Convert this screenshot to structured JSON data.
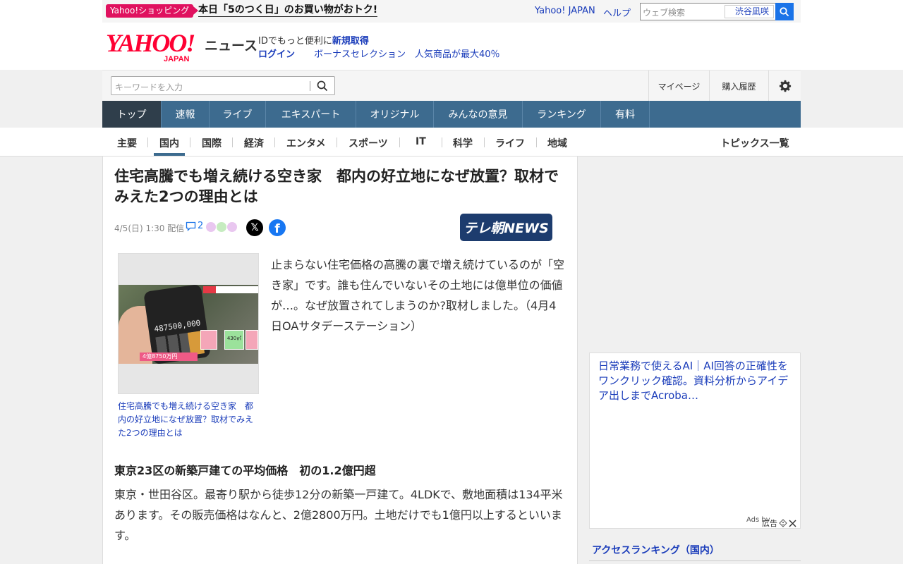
{
  "topbar": {
    "promo_badge": "Yahoo!ショッピング",
    "promo_text": "本日「5のつく日」のお買い物がおトク!",
    "links": [
      "Yahoo! JAPAN",
      "ヘルプ"
    ],
    "web_search_placeholder": "ウェブ検索",
    "web_search_scope": "渋谷凪咲"
  },
  "header": {
    "logo_main": "YAHOO!",
    "logo_sub": "JAPAN",
    "section": "ニュース",
    "id_text": "IDでもっと便利に",
    "id_link": "新規取得",
    "login": "ログイン",
    "promo": "ボーナスセレクション　人気商品が最大40％"
  },
  "toolbar": {
    "search_placeholder": "キーワードを入力",
    "mypage": "マイページ",
    "purchase_history": "購入履歴",
    "settings_icon": "gear-icon"
  },
  "global_nav": [
    "トップ",
    "速報",
    "ライブ",
    "エキスパート",
    "オリジナル",
    "みんなの意見",
    "ランキング",
    "有料"
  ],
  "global_nav_active": "トップ",
  "sub_nav": [
    "主要",
    "国内",
    "国際",
    "経済",
    "エンタメ",
    "スポーツ",
    "IT",
    "科学",
    "ライフ",
    "地域"
  ],
  "sub_nav_active": "国内",
  "topics_link": "トピックス一覧",
  "article": {
    "title": "住宅高騰でも増え続ける空き家　都内の好立地になぜ放置？取材でみえた2つの理由とは",
    "date": "4/5(日) 1:30 配信",
    "comment_count": "2",
    "source": "テレ朝NEWS",
    "photo_caption": "住宅高騰でも増え続ける空き家　都内の好立地になぜ放置？取材でみえた2つの理由とは",
    "photo_text": {
      "calc_number": "487500,000",
      "price_tag": "4億8750万円",
      "plot_area": "430㎡"
    },
    "lead": "止まらない住宅価格の高騰の裏で増え続けているのが「空き家」です。誰も住んでいないその土地には億単位の価値が…。なぜ放置されてしまうのか?取材しました。（4月4日OAサタデーステーション）",
    "subhead": "東京23区の新築戸建ての平均価格　初の1.2億円超",
    "body": "東京・世田谷区。最寄り駅から徒歩12分の新築一戸建て。4LDKで、敷地面積は134平米あります。その販売価格はなんと、2億2800万円。土地だけでも1億円以上するといいます。"
  },
  "sidebar": {
    "ad_text": "日常業務で使えるAI｜AI回答の正確性をワンクリック確認。資料分析からアイデア出しまでAcroba…",
    "ad_choices": "Ads by",
    "ad_label": "広告",
    "ranking_title": "アクセスランキング（国内）"
  },
  "colors": {
    "brand_red": "#ff0033",
    "nav_blue": "#3d6b8f",
    "nav_active": "#2f3e4b",
    "link_blue": "#1a3cba",
    "promo_pink": "#e0115f"
  }
}
